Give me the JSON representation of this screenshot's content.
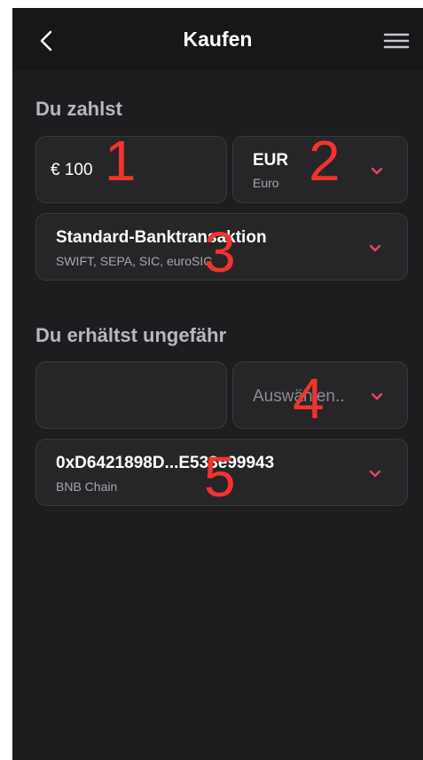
{
  "header": {
    "title": "Kaufen"
  },
  "pay": {
    "section_title": "Du zahlst",
    "amount_value": "€ 100",
    "currency_code": "EUR",
    "currency_name": "Euro",
    "method_title": "Standard-Banktransaktion",
    "method_subtitle": "SWIFT, SEPA, SIC, euroSIC"
  },
  "receive": {
    "section_title": "Du erhältst ungefähr",
    "amount_value": "",
    "asset_placeholder": "Auswählen..",
    "wallet_address": "0xD6421898D...E533e99943",
    "network": "BNB Chain"
  },
  "annotations": [
    "1",
    "2",
    "3",
    "4",
    "5"
  ],
  "colors": {
    "background": "#1d1d1f",
    "header": "#171719",
    "card": "#262628",
    "border": "#3a3a3e",
    "accent_chevron": "#e8455c",
    "annotation": "#f2332e"
  }
}
